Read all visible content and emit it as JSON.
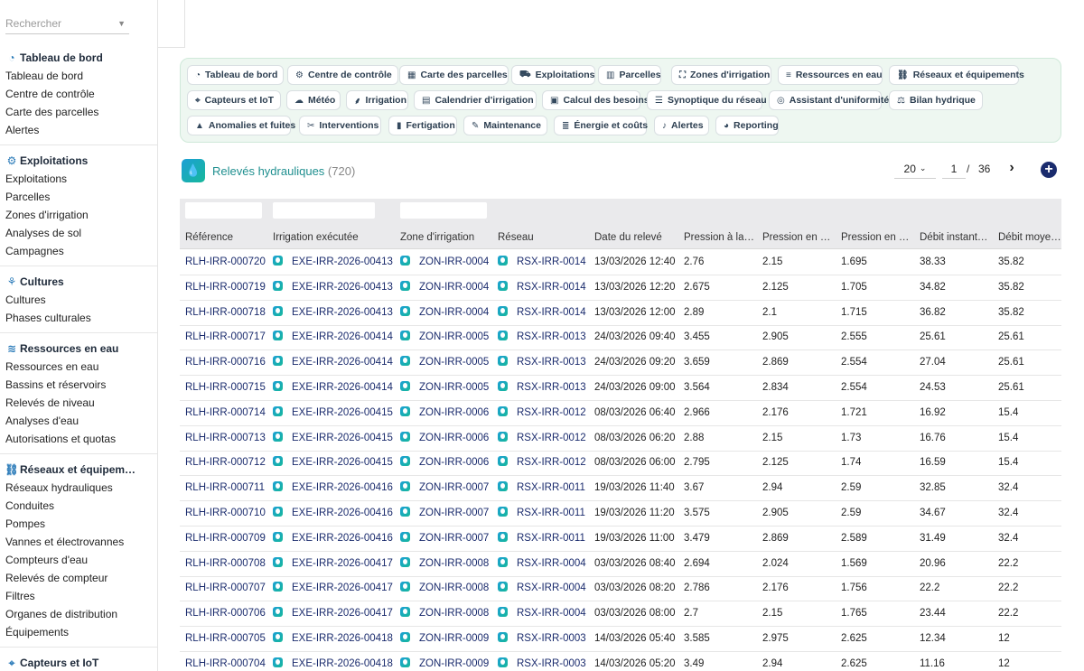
{
  "search": {
    "placeholder": "Rechercher"
  },
  "sidebar": {
    "sections": [
      {
        "title": "Tableau de bord",
        "icon": "gauge-icon",
        "items": [
          "Tableau de bord",
          "Centre de contrôle",
          "Carte des parcelles",
          "Alertes"
        ]
      },
      {
        "title": "Exploitations",
        "icon": "tractor-icon",
        "items": [
          "Exploitations",
          "Parcelles",
          "Zones d'irrigation",
          "Analyses de sol",
          "Campagnes"
        ]
      },
      {
        "title": "Cultures",
        "icon": "seedling-icon",
        "items": [
          "Cultures",
          "Phases culturales"
        ]
      },
      {
        "title": "Ressources en eau",
        "icon": "water-icon",
        "items": [
          "Ressources en eau",
          "Bassins et réservoirs",
          "Relevés de niveau",
          "Analyses d'eau",
          "Autorisations et quotas"
        ]
      },
      {
        "title": "Réseaux et équipem…",
        "icon": "network-icon",
        "items": [
          "Réseaux hydrauliques",
          "Conduites",
          "Pompes",
          "Vannes et électrovannes",
          "Compteurs d'eau",
          "Relevés de compteur",
          "Filtres",
          "Organes de distribution",
          "Équipements"
        ]
      },
      {
        "title": "Capteurs et IoT",
        "icon": "sensor-icon",
        "items": []
      }
    ]
  },
  "nav": {
    "rows": [
      [
        {
          "label": "Tableau de bord",
          "icon": "gauge-icon"
        },
        {
          "label": "Centre de contrôle",
          "icon": "control-icon"
        },
        {
          "label": "Carte des parcelles",
          "icon": "map-icon"
        },
        {
          "label": "Exploitations",
          "icon": "tractor-icon"
        },
        {
          "label": "Parcelles",
          "icon": "fields-icon"
        },
        {
          "label": "Zones d'irrigation",
          "icon": "zones-icon"
        },
        {
          "label": "Ressources en eau",
          "icon": "water-icon"
        },
        {
          "label": "Réseaux et équipements",
          "icon": "network-icon"
        }
      ],
      [
        {
          "label": "Capteurs et IoT",
          "icon": "sensor-icon"
        },
        {
          "label": "Météo",
          "icon": "weather-icon"
        },
        {
          "label": "Irrigation",
          "icon": "sprinkler-icon"
        },
        {
          "label": "Calendrier d'irrigation",
          "icon": "calendar-icon"
        },
        {
          "label": "Calcul des besoins",
          "icon": "calculator-icon"
        },
        {
          "label": "Synoptique du réseau",
          "icon": "list-icon"
        },
        {
          "label": "Assistant d'uniformité",
          "icon": "target-icon"
        },
        {
          "label": "Bilan hydrique",
          "icon": "balance-icon"
        }
      ],
      [
        {
          "label": "Anomalies et fuites",
          "icon": "warning-icon"
        },
        {
          "label": "Interventions",
          "icon": "tools-icon"
        },
        {
          "label": "Fertigation",
          "icon": "flask-icon"
        },
        {
          "label": "Maintenance",
          "icon": "wrench-icon"
        },
        {
          "label": "Énergie et coûts",
          "icon": "coins-icon"
        },
        {
          "label": "Alertes",
          "icon": "bell-icon"
        },
        {
          "label": "Reporting",
          "icon": "chart-pie-icon"
        }
      ]
    ]
  },
  "page": {
    "title": "Relevés hydrauliques",
    "count": "(720)",
    "page_size": "20",
    "page_number": "1",
    "page_separator": "/",
    "page_total": "36"
  },
  "table": {
    "columns": [
      "Référence",
      "Irrigation exécutée",
      "Zone d'irrigation",
      "Réseau",
      "Date du relevé",
      "Pression à la…",
      "Pression en …",
      "Pression en …",
      "Débit instant…",
      "Débit moyen…"
    ],
    "rows": [
      [
        "RLH-IRR-000720",
        "EXE-IRR-2026-00413",
        "ZON-IRR-0004",
        "RSX-IRR-0014",
        "13/03/2026 12:40",
        "2.76",
        "2.15",
        "1.695",
        "38.33",
        "35.82"
      ],
      [
        "RLH-IRR-000719",
        "EXE-IRR-2026-00413",
        "ZON-IRR-0004",
        "RSX-IRR-0014",
        "13/03/2026 12:20",
        "2.675",
        "2.125",
        "1.705",
        "34.82",
        "35.82"
      ],
      [
        "RLH-IRR-000718",
        "EXE-IRR-2026-00413",
        "ZON-IRR-0004",
        "RSX-IRR-0014",
        "13/03/2026 12:00",
        "2.89",
        "2.1",
        "1.715",
        "36.82",
        "35.82"
      ],
      [
        "RLH-IRR-000717",
        "EXE-IRR-2026-00414",
        "ZON-IRR-0005",
        "RSX-IRR-0013",
        "24/03/2026 09:40",
        "3.455",
        "2.905",
        "2.555",
        "25.61",
        "25.61"
      ],
      [
        "RLH-IRR-000716",
        "EXE-IRR-2026-00414",
        "ZON-IRR-0005",
        "RSX-IRR-0013",
        "24/03/2026 09:20",
        "3.659",
        "2.869",
        "2.554",
        "27.04",
        "25.61"
      ],
      [
        "RLH-IRR-000715",
        "EXE-IRR-2026-00414",
        "ZON-IRR-0005",
        "RSX-IRR-0013",
        "24/03/2026 09:00",
        "3.564",
        "2.834",
        "2.554",
        "24.53",
        "25.61"
      ],
      [
        "RLH-IRR-000714",
        "EXE-IRR-2026-00415",
        "ZON-IRR-0006",
        "RSX-IRR-0012",
        "08/03/2026 06:40",
        "2.966",
        "2.176",
        "1.721",
        "16.92",
        "15.4"
      ],
      [
        "RLH-IRR-000713",
        "EXE-IRR-2026-00415",
        "ZON-IRR-0006",
        "RSX-IRR-0012",
        "08/03/2026 06:20",
        "2.88",
        "2.15",
        "1.73",
        "16.76",
        "15.4"
      ],
      [
        "RLH-IRR-000712",
        "EXE-IRR-2026-00415",
        "ZON-IRR-0006",
        "RSX-IRR-0012",
        "08/03/2026 06:00",
        "2.795",
        "2.125",
        "1.74",
        "16.59",
        "15.4"
      ],
      [
        "RLH-IRR-000711",
        "EXE-IRR-2026-00416",
        "ZON-IRR-0007",
        "RSX-IRR-0011",
        "19/03/2026 11:40",
        "3.67",
        "2.94",
        "2.59",
        "32.85",
        "32.4"
      ],
      [
        "RLH-IRR-000710",
        "EXE-IRR-2026-00416",
        "ZON-IRR-0007",
        "RSX-IRR-0011",
        "19/03/2026 11:20",
        "3.575",
        "2.905",
        "2.59",
        "34.67",
        "32.4"
      ],
      [
        "RLH-IRR-000709",
        "EXE-IRR-2026-00416",
        "ZON-IRR-0007",
        "RSX-IRR-0011",
        "19/03/2026 11:00",
        "3.479",
        "2.869",
        "2.589",
        "31.49",
        "32.4"
      ],
      [
        "RLH-IRR-000708",
        "EXE-IRR-2026-00417",
        "ZON-IRR-0008",
        "RSX-IRR-0004",
        "03/03/2026 08:40",
        "2.694",
        "2.024",
        "1.569",
        "20.96",
        "22.2"
      ],
      [
        "RLH-IRR-000707",
        "EXE-IRR-2026-00417",
        "ZON-IRR-0008",
        "RSX-IRR-0004",
        "03/03/2026 08:20",
        "2.786",
        "2.176",
        "1.756",
        "22.2",
        "22.2"
      ],
      [
        "RLH-IRR-000706",
        "EXE-IRR-2026-00417",
        "ZON-IRR-0008",
        "RSX-IRR-0004",
        "03/03/2026 08:00",
        "2.7",
        "2.15",
        "1.765",
        "23.44",
        "22.2"
      ],
      [
        "RLH-IRR-000705",
        "EXE-IRR-2026-00418",
        "ZON-IRR-0009",
        "RSX-IRR-0003",
        "14/03/2026 05:40",
        "3.585",
        "2.975",
        "2.625",
        "12.34",
        "12"
      ],
      [
        "RLH-IRR-000704",
        "EXE-IRR-2026-00418",
        "ZON-IRR-0009",
        "RSX-IRR-0003",
        "14/03/2026 05:20",
        "3.49",
        "2.94",
        "2.625",
        "11.16",
        "12"
      ]
    ]
  },
  "colors": {
    "link": "#1a2b6d",
    "accent": "#1f8f8f",
    "panel": "#eef7f1",
    "header_bg": "#eaeaec",
    "add_button": "#1a2b6d"
  }
}
